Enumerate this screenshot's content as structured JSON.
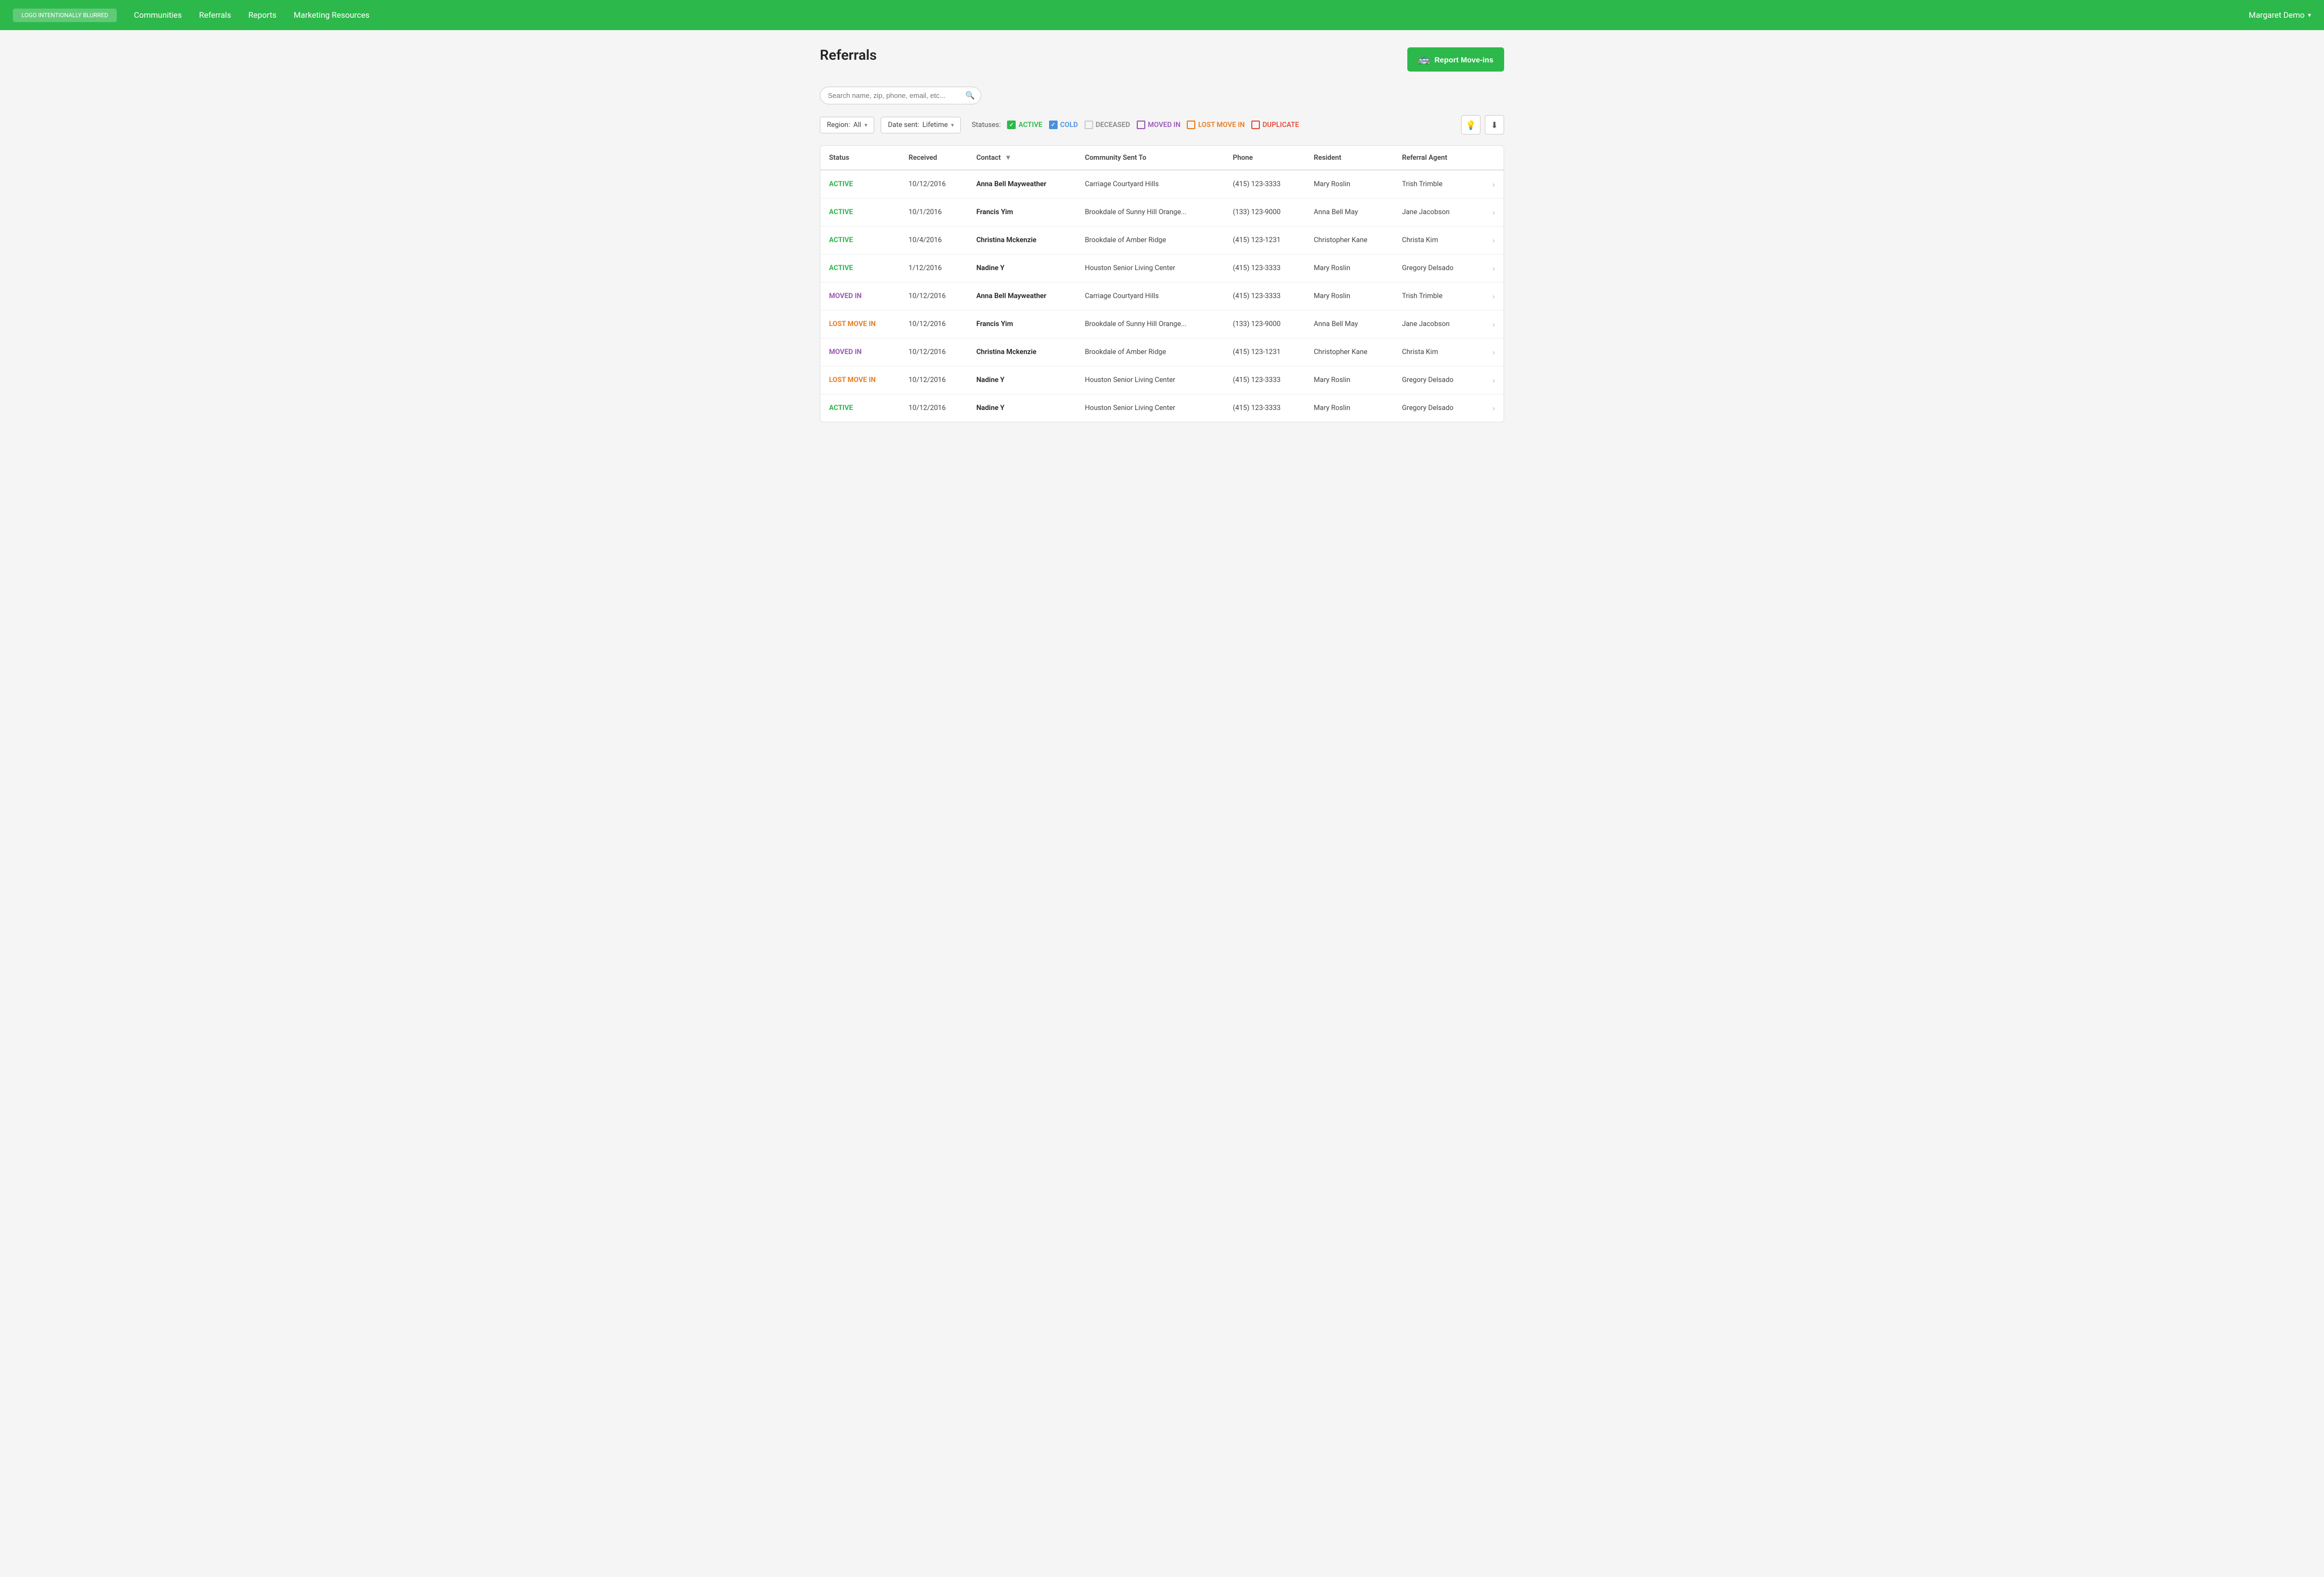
{
  "nav": {
    "logo": "LOGO INTENTIONALLY BLURRED",
    "links": [
      "Communities",
      "Referrals",
      "Reports",
      "Marketing Resources"
    ],
    "user": "Margaret Demo"
  },
  "page": {
    "title": "Referrals",
    "report_btn": "Report Move-ins"
  },
  "search": {
    "placeholder": "Search name, zip, phone, email, etc..."
  },
  "filters": {
    "region_label": "Region:",
    "region_value": "All",
    "date_label": "Date sent:",
    "date_value": "Lifetime",
    "statuses_label": "Statuses:",
    "statuses": [
      {
        "key": "active",
        "label": "ACTIVE",
        "checked": true,
        "color_class": "status-active",
        "checkbox_class": "checked-green"
      },
      {
        "key": "cold",
        "label": "COLD",
        "checked": true,
        "color_class": "status-cold",
        "checkbox_class": "checked-blue"
      },
      {
        "key": "deceased",
        "label": "DECEASED",
        "checked": false,
        "color_class": "status-deceased",
        "checkbox_class": "unchecked-gray"
      },
      {
        "key": "moved_in",
        "label": "MOVED IN",
        "checked": false,
        "color_class": "status-moved-in",
        "checkbox_class": "unchecked-purple"
      },
      {
        "key": "lost_move_in",
        "label": "LOST MOVE IN",
        "checked": false,
        "color_class": "status-lost-move-in",
        "checkbox_class": "unchecked-orange"
      },
      {
        "key": "duplicate",
        "label": "DUPLICATE",
        "checked": false,
        "color_class": "status-duplicate",
        "checkbox_class": "unchecked-red"
      }
    ]
  },
  "table": {
    "columns": [
      "Status",
      "Received",
      "Contact",
      "Community Sent To",
      "Phone",
      "Resident",
      "Referral Agent"
    ],
    "rows": [
      {
        "status": "ACTIVE",
        "status_class": "status-active",
        "received": "10/12/2016",
        "contact": "Anna Bell Mayweather",
        "community": "Carriage Courtyard Hills",
        "phone": "(415) 123-3333",
        "resident": "Mary Roslin",
        "agent": "Trish Trimble"
      },
      {
        "status": "ACTIVE",
        "status_class": "status-active",
        "received": "10/1/2016",
        "contact": "Francis Yim",
        "community": "Brookdale of Sunny Hill Orange...",
        "phone": "(133) 123-9000",
        "resident": "Anna Bell May",
        "agent": "Jane Jacobson"
      },
      {
        "status": "ACTIVE",
        "status_class": "status-active",
        "received": "10/4/2016",
        "contact": "Christina Mckenzie",
        "community": "Brookdale of Amber Ridge",
        "phone": "(415) 123-1231",
        "resident": "Christopher Kane",
        "agent": "Christa Kim"
      },
      {
        "status": "ACTIVE",
        "status_class": "status-active",
        "received": "1/12/2016",
        "contact": "Nadine Y",
        "community": "Houston Senior Living Center",
        "phone": "(415) 123-3333",
        "resident": "Mary Roslin",
        "agent": "Gregory Delsado"
      },
      {
        "status": "MOVED IN",
        "status_class": "status-moved-in",
        "received": "10/12/2016",
        "contact": "Anna Bell Mayweather",
        "community": "Carriage Courtyard Hills",
        "phone": "(415) 123-3333",
        "resident": "Mary Roslin",
        "agent": "Trish Trimble"
      },
      {
        "status": "LOST MOVE IN",
        "status_class": "status-lost-move-in",
        "received": "10/12/2016",
        "contact": "Francis Yim",
        "community": "Brookdale of Sunny Hill Orange...",
        "phone": "(133) 123-9000",
        "resident": "Anna Bell May",
        "agent": "Jane Jacobson"
      },
      {
        "status": "MOVED IN",
        "status_class": "status-moved-in",
        "received": "10/12/2016",
        "contact": "Christina Mckenzie",
        "community": "Brookdale of Amber Ridge",
        "phone": "(415) 123-1231",
        "resident": "Christopher Kane",
        "agent": "Christa Kim"
      },
      {
        "status": "LOST MOVE IN",
        "status_class": "status-lost-move-in",
        "received": "10/12/2016",
        "contact": "Nadine Y",
        "community": "Houston Senior Living Center",
        "phone": "(415) 123-3333",
        "resident": "Mary Roslin",
        "agent": "Gregory Delsado"
      },
      {
        "status": "ACTIVE",
        "status_class": "status-active",
        "received": "10/12/2016",
        "contact": "Nadine Y",
        "community": "Houston Senior Living Center",
        "phone": "(415) 123-3333",
        "resident": "Mary Roslin",
        "agent": "Gregory Delsado"
      }
    ]
  }
}
